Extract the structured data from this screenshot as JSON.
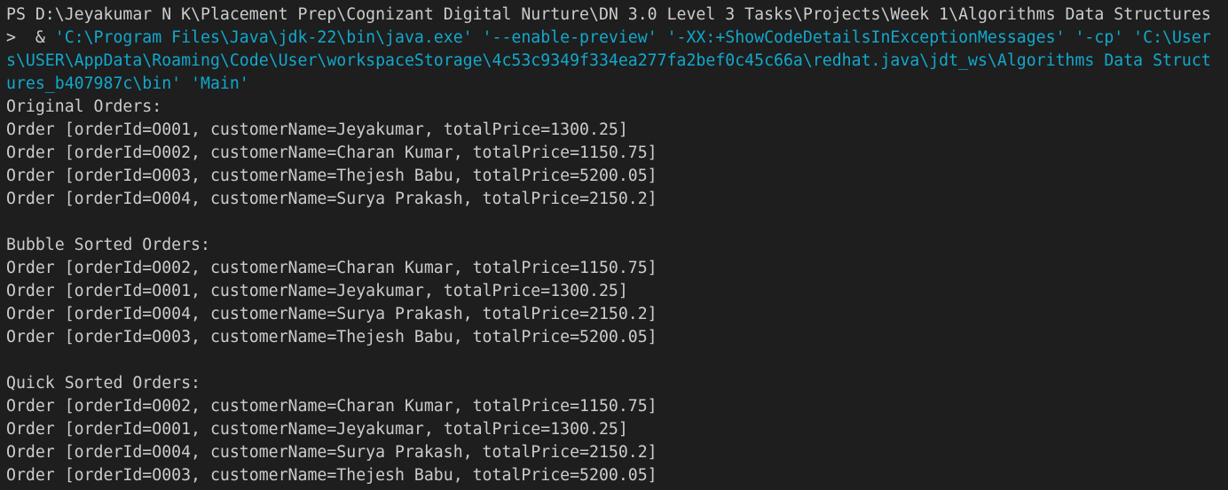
{
  "colors": {
    "background": "#1e1e1e",
    "text": "#cccccc",
    "string": "#11a8cd"
  },
  "prompt": "PS D:\\Jeyakumar N K\\Placement Prep\\Cognizant Digital Nurture\\DN 3.0 Level 3 Tasks\\Projects\\Week 1\\Algorithms Data Structures",
  "command": {
    "prefix": ">  & ",
    "line1": "'C:\\Program Files\\Java\\jdk-22\\bin\\java.exe' '--enable-preview' '-XX:+ShowCodeDetailsInExceptionMessages' '-cp' 'C:\\User",
    "line2": "s\\USER\\AppData\\Roaming\\Code\\User\\workspaceStorage\\4c53c9349f334ea277fa2bef0c45c66a\\redhat.java\\jdt_ws\\Algorithms Data Struct",
    "line3": "ures_b407987c\\bin' 'Main'"
  },
  "sections": [
    {
      "title": "Original Orders:",
      "orders": [
        "Order [orderId=O001, customerName=Jeyakumar, totalPrice=1300.25]",
        "Order [orderId=O002, customerName=Charan Kumar, totalPrice=1150.75]",
        "Order [orderId=O003, customerName=Thejesh Babu, totalPrice=5200.05]",
        "Order [orderId=O004, customerName=Surya Prakash, totalPrice=2150.2]"
      ]
    },
    {
      "title": "Bubble Sorted Orders:",
      "orders": [
        "Order [orderId=O002, customerName=Charan Kumar, totalPrice=1150.75]",
        "Order [orderId=O001, customerName=Jeyakumar, totalPrice=1300.25]",
        "Order [orderId=O004, customerName=Surya Prakash, totalPrice=2150.2]",
        "Order [orderId=O003, customerName=Thejesh Babu, totalPrice=5200.05]"
      ]
    },
    {
      "title": "Quick Sorted Orders:",
      "orders": [
        "Order [orderId=O002, customerName=Charan Kumar, totalPrice=1150.75]",
        "Order [orderId=O001, customerName=Jeyakumar, totalPrice=1300.25]",
        "Order [orderId=O004, customerName=Surya Prakash, totalPrice=2150.2]",
        "Order [orderId=O003, customerName=Thejesh Babu, totalPrice=5200.05]"
      ]
    }
  ]
}
